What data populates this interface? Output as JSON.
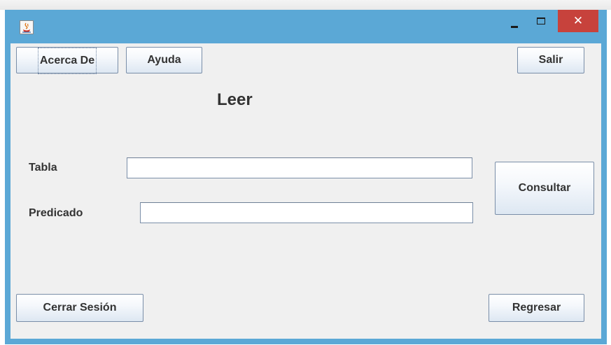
{
  "window": {
    "app_icon": "java-cup-icon",
    "controls": {
      "minimize_icon": "minimize-icon",
      "maximize_icon": "maximize-icon",
      "close_glyph": "✕"
    }
  },
  "toolbar": {
    "about_label": "Acerca De",
    "help_label": "Ayuda",
    "exit_label": "Salir"
  },
  "form": {
    "title": "Leer",
    "table_label": "Tabla",
    "table_value": "",
    "predicate_label": "Predicado",
    "predicate_value": "",
    "query_label": "Consultar"
  },
  "footer": {
    "logout_label": "Cerrar Sesión",
    "back_label": "Regresar"
  },
  "colors": {
    "titlebar": "#5ba8d6",
    "close_button": "#c7423c",
    "panel": "#f0f0f0"
  }
}
